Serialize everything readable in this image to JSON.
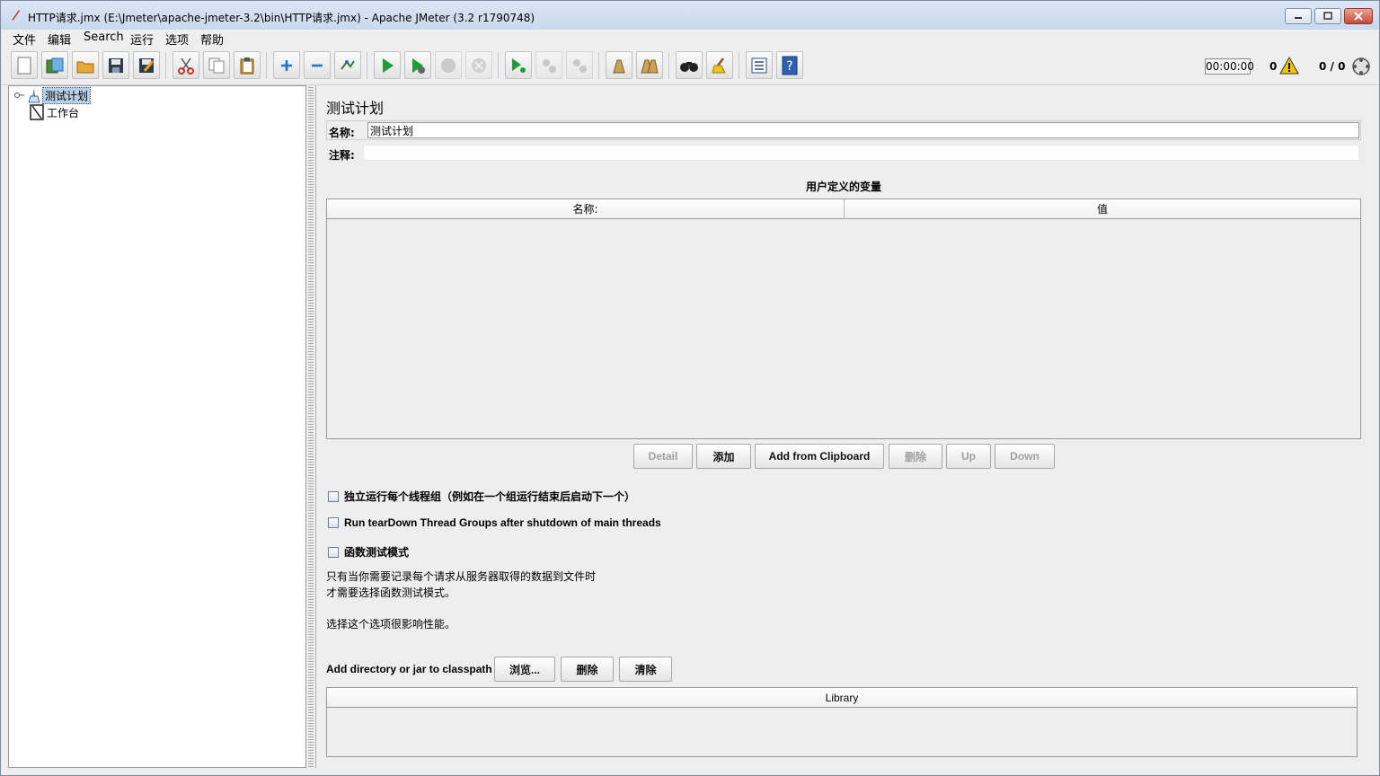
{
  "window": {
    "title": "HTTP请求.jmx (E:\\Jmeter\\apache-jmeter-3.2\\bin\\HTTP请求.jmx) - Apache JMeter (3.2 r1790748)"
  },
  "menu": [
    "文件",
    "编辑",
    "Search",
    "运行",
    "选项",
    "帮助"
  ],
  "toolbar": {
    "buttons": [
      {
        "icon": "new-icon"
      },
      {
        "icon": "templates-icon"
      },
      {
        "icon": "open-icon"
      },
      {
        "icon": "save-icon"
      },
      {
        "icon": "save-as-icon"
      },
      {
        "icon": "cut-icon"
      },
      {
        "icon": "copy-icon"
      },
      {
        "icon": "paste-icon"
      },
      {
        "icon": "expand-icon"
      },
      {
        "icon": "collapse-icon"
      },
      {
        "icon": "toggle-icon"
      },
      {
        "icon": "start-icon"
      },
      {
        "icon": "start-no-pause-icon"
      },
      {
        "icon": "stop-icon"
      },
      {
        "icon": "shutdown-icon"
      },
      {
        "icon": "remote-start-icon"
      },
      {
        "icon": "remote-stop-icon"
      },
      {
        "icon": "remote-shutdown-icon"
      },
      {
        "icon": "clear-icon"
      },
      {
        "icon": "clear-all-icon"
      },
      {
        "icon": "search-icon"
      },
      {
        "icon": "reset-search-icon"
      },
      {
        "icon": "function-helper-icon"
      },
      {
        "icon": "help-icon"
      }
    ],
    "timer": "00:00:00",
    "error_count": "0",
    "threads": "0 / 0"
  },
  "tree": {
    "items": [
      {
        "label": "测试计划",
        "selected": true
      },
      {
        "label": "工作台",
        "selected": false
      }
    ]
  },
  "main": {
    "title": "测试计划",
    "name_label": "名称:",
    "name_value": "测试计划",
    "comment_label": "注释:",
    "comment_value": "",
    "variables_caption": "用户定义的变量",
    "columns": [
      "名称:",
      "值"
    ],
    "buttons": {
      "detail": "Detail",
      "add": "添加",
      "add_clipboard": "Add from Clipboard",
      "delete": "删除",
      "up": "Up",
      "down": "Down"
    },
    "checks": [
      {
        "label": "独立运行每个线程组（例如在一个组运行结束后启动下一个）",
        "checked": false
      },
      {
        "label": "Run tearDown Thread Groups after shutdown of main threads",
        "checked": false
      },
      {
        "label": "函数测试模式",
        "checked": false
      }
    ],
    "note_line1": "只有当你需要记录每个请求从服务器取得的数据到文件时",
    "note_line2": "才需要选择函数测试模式。",
    "note_line3": "选择这个选项很影响性能。",
    "classpath_label": "Add directory or jar to classpath",
    "cp_buttons": {
      "browse": "浏览...",
      "delete": "删除",
      "clear": "清除"
    },
    "library_header": "Library"
  }
}
